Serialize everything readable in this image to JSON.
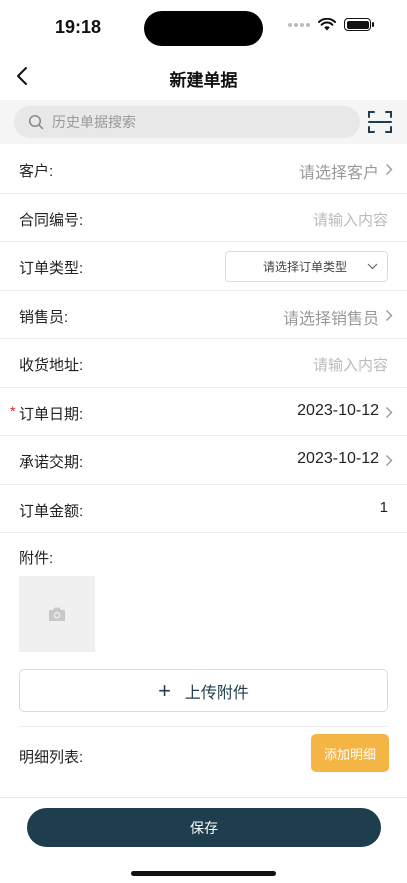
{
  "status_bar": {
    "time": "19:18"
  },
  "nav": {
    "title": "新建单据"
  },
  "search": {
    "placeholder": "历史单据搜索"
  },
  "form": {
    "customer": {
      "label": "客户:",
      "value": "请选择客户"
    },
    "contract_no": {
      "label": "合同编号:",
      "placeholder": "请输入内容"
    },
    "order_type": {
      "label": "订单类型:",
      "selected": "请选择订单类型"
    },
    "salesperson": {
      "label": "销售员:",
      "value": "请选择销售员"
    },
    "address": {
      "label": "收货地址:",
      "placeholder": "请输入内容"
    },
    "order_date": {
      "required_mark": "*",
      "label": "订单日期:",
      "value": "2023-10-12"
    },
    "promise_date": {
      "label": "承诺交期:",
      "value": "2023-10-12"
    },
    "order_amount": {
      "label": "订单金额:",
      "value": "1"
    }
  },
  "attachments": {
    "label": "附件:",
    "upload_label": "上传附件",
    "upload_plus": "+"
  },
  "details": {
    "label": "明细列表:",
    "add_label": "添加明细"
  },
  "footer": {
    "save_label": "保存"
  },
  "colors": {
    "primary": "#1e3d4d",
    "accent": "#f5b545",
    "required": "#e02020"
  }
}
